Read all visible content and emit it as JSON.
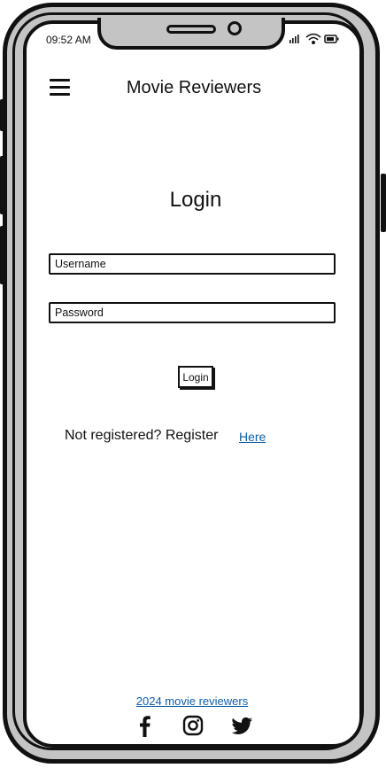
{
  "status_bar": {
    "time": "09:52 AM"
  },
  "header": {
    "title": "Movie Reviewers"
  },
  "login": {
    "heading": "Login",
    "username_placeholder": "Username",
    "password_placeholder": "Password",
    "button_label": "Login"
  },
  "register": {
    "prompt": "Not registered? Register",
    "link": "Here"
  },
  "footer": {
    "link": "2024 movie reviewers",
    "social": [
      "facebook-icon",
      "instagram-icon",
      "twitter-icon"
    ]
  },
  "colors": {
    "link": "#0d5fa8",
    "frame": "#c4c4c4",
    "ink": "#111111"
  }
}
